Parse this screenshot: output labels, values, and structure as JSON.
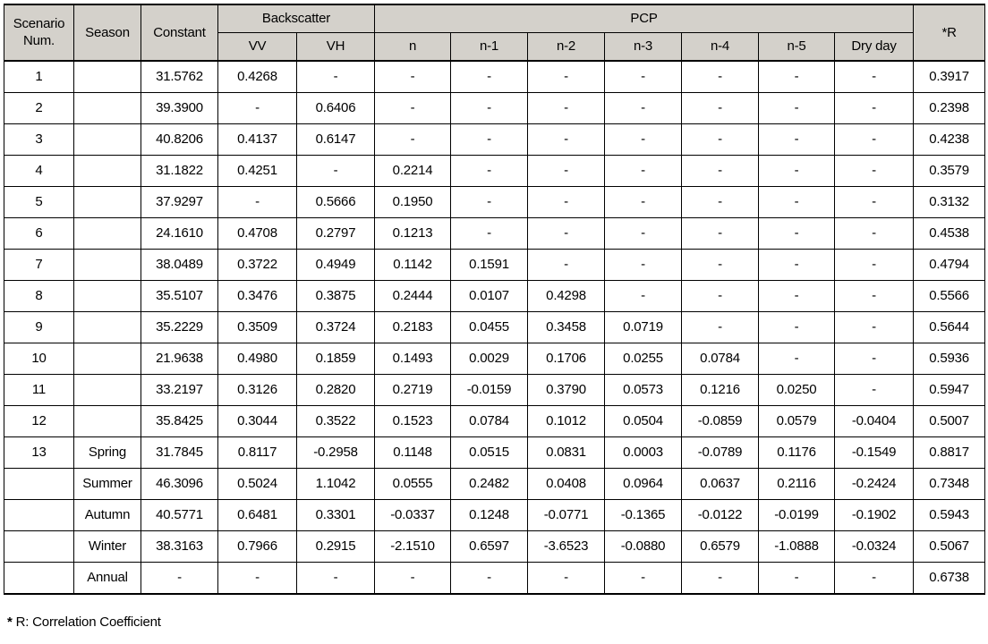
{
  "table": {
    "header": {
      "scenario_num": "Scenario Num.",
      "scenario_num_line1": "Scenario",
      "scenario_num_line2": "Num.",
      "season": "Season",
      "constant": "Constant",
      "backscatter_group": "Backscatter",
      "pcp_group": "PCP",
      "vv": "VV",
      "vh": "VH",
      "n": "n",
      "n1": "n-1",
      "n2": "n-2",
      "n3": "n-3",
      "n4": "n-4",
      "n5": "n-5",
      "dry_day": "Dry  day",
      "r": "*R"
    },
    "columns": [
      "Scenario Num.",
      "Season",
      "Constant",
      "VV",
      "VH",
      "n",
      "n-1",
      "n-2",
      "n-3",
      "n-4",
      "n-5",
      "Dry  day",
      "*R"
    ],
    "rows": [
      {
        "scenario": "1",
        "season": "",
        "constant": "31.5762",
        "vv": "0.4268",
        "vh": "-",
        "n": "-",
        "n1": "-",
        "n2": "-",
        "n3": "-",
        "n4": "-",
        "n5": "-",
        "dry_day": "-",
        "r": "0.3917"
      },
      {
        "scenario": "2",
        "season": "",
        "constant": "39.3900",
        "vv": "-",
        "vh": "0.6406",
        "n": "-",
        "n1": "-",
        "n2": "-",
        "n3": "-",
        "n4": "-",
        "n5": "-",
        "dry_day": "-",
        "r": "0.2398"
      },
      {
        "scenario": "3",
        "season": "",
        "constant": "40.8206",
        "vv": "0.4137",
        "vh": "0.6147",
        "n": "-",
        "n1": "-",
        "n2": "-",
        "n3": "-",
        "n4": "-",
        "n5": "-",
        "dry_day": "-",
        "r": "0.4238"
      },
      {
        "scenario": "4",
        "season": "",
        "constant": "31.1822",
        "vv": "0.4251",
        "vh": "-",
        "n": "0.2214",
        "n1": "-",
        "n2": "-",
        "n3": "-",
        "n4": "-",
        "n5": "-",
        "dry_day": "-",
        "r": "0.3579"
      },
      {
        "scenario": "5",
        "season": "",
        "constant": "37.9297",
        "vv": "-",
        "vh": "0.5666",
        "n": "0.1950",
        "n1": "-",
        "n2": "-",
        "n3": "-",
        "n4": "-",
        "n5": "-",
        "dry_day": "-",
        "r": "0.3132"
      },
      {
        "scenario": "6",
        "season": "",
        "constant": "24.1610",
        "vv": "0.4708",
        "vh": "0.2797",
        "n": "0.1213",
        "n1": "-",
        "n2": "-",
        "n3": "-",
        "n4": "-",
        "n5": "-",
        "dry_day": "-",
        "r": "0.4538"
      },
      {
        "scenario": "7",
        "season": "",
        "constant": "38.0489",
        "vv": "0.3722",
        "vh": "0.4949",
        "n": "0.1142",
        "n1": "0.1591",
        "n2": "-",
        "n3": "-",
        "n4": "-",
        "n5": "-",
        "dry_day": "-",
        "r": "0.4794"
      },
      {
        "scenario": "8",
        "season": "",
        "constant": "35.5107",
        "vv": "0.3476",
        "vh": "0.3875",
        "n": "0.2444",
        "n1": "0.0107",
        "n2": "0.4298",
        "n3": "-",
        "n4": "-",
        "n5": "-",
        "dry_day": "-",
        "r": "0.5566"
      },
      {
        "scenario": "9",
        "season": "",
        "constant": "35.2229",
        "vv": "0.3509",
        "vh": "0.3724",
        "n": "0.2183",
        "n1": "0.0455",
        "n2": "0.3458",
        "n3": "0.0719",
        "n4": "-",
        "n5": "-",
        "dry_day": "-",
        "r": "0.5644"
      },
      {
        "scenario": "10",
        "season": "",
        "constant": "21.9638",
        "vv": "0.4980",
        "vh": "0.1859",
        "n": "0.1493",
        "n1": "0.0029",
        "n2": "0.1706",
        "n3": "0.0255",
        "n4": "0.0784",
        "n5": "-",
        "dry_day": "-",
        "r": "0.5936"
      },
      {
        "scenario": "11",
        "season": "",
        "constant": "33.2197",
        "vv": "0.3126",
        "vh": "0.2820",
        "n": "0.2719",
        "n1": "-0.0159",
        "n2": "0.3790",
        "n3": "0.0573",
        "n4": "0.1216",
        "n5": "0.0250",
        "dry_day": "-",
        "r": "0.5947"
      },
      {
        "scenario": "12",
        "season": "",
        "constant": "35.8425",
        "vv": "0.3044",
        "vh": "0.3522",
        "n": "0.1523",
        "n1": "0.0784",
        "n2": "0.1012",
        "n3": "0.0504",
        "n4": "-0.0859",
        "n5": "0.0579",
        "dry_day": "-0.0404",
        "r": "0.5007"
      },
      {
        "scenario": "13",
        "season": "Spring",
        "constant": "31.7845",
        "vv": "0.8117",
        "vh": "-0.2958",
        "n": "0.1148",
        "n1": "0.0515",
        "n2": "0.0831",
        "n3": "0.0003",
        "n4": "-0.0789",
        "n5": "0.1176",
        "dry_day": "-0.1549",
        "r": "0.8817"
      },
      {
        "scenario": "",
        "season": "Summer",
        "constant": "46.3096",
        "vv": "0.5024",
        "vh": "1.1042",
        "n": "0.0555",
        "n1": "0.2482",
        "n2": "0.0408",
        "n3": "0.0964",
        "n4": "0.0637",
        "n5": "0.2116",
        "dry_day": "-0.2424",
        "r": "0.7348"
      },
      {
        "scenario": "",
        "season": "Autumn",
        "constant": "40.5771",
        "vv": "0.6481",
        "vh": "0.3301",
        "n": "-0.0337",
        "n1": "0.1248",
        "n2": "-0.0771",
        "n3": "-0.1365",
        "n4": "-0.0122",
        "n5": "-0.0199",
        "dry_day": "-0.1902",
        "r": "0.5943"
      },
      {
        "scenario": "",
        "season": "Winter",
        "constant": "38.3163",
        "vv": "0.7966",
        "vh": "0.2915",
        "n": "-2.1510",
        "n1": "0.6597",
        "n2": "-3.6523",
        "n3": "-0.0880",
        "n4": "0.6579",
        "n5": "-1.0888",
        "dry_day": "-0.0324",
        "r": "0.5067"
      },
      {
        "scenario": "",
        "season": "Annual",
        "constant": "-",
        "vv": "-",
        "vh": "-",
        "n": "-",
        "n1": "-",
        "n2": "-",
        "n3": "-",
        "n4": "-",
        "n5": "-",
        "dry_day": "-",
        "r": "0.6738"
      }
    ]
  },
  "footnote": {
    "star": "*",
    "text": " R:  Correlation  Coefficient"
  },
  "colors": {
    "header_background": "#d4d1cb",
    "border": "#000000",
    "text": "#000000",
    "cell_background": "#ffffff"
  }
}
